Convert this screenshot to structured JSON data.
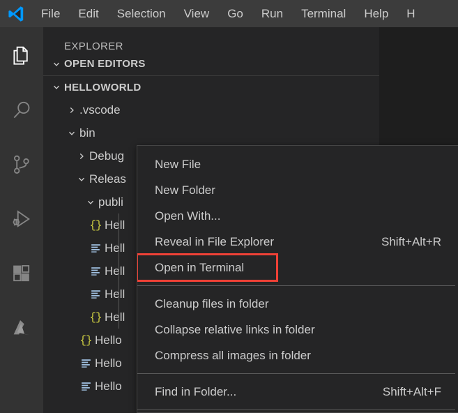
{
  "app": {
    "logo_icon": "vscode-logo-icon",
    "accent_color": "#0098ff",
    "highlight_color": "#ef4136"
  },
  "menubar": {
    "items": [
      {
        "label": "File"
      },
      {
        "label": "Edit"
      },
      {
        "label": "Selection"
      },
      {
        "label": "View"
      },
      {
        "label": "Go"
      },
      {
        "label": "Run"
      },
      {
        "label": "Terminal"
      },
      {
        "label": "Help"
      },
      {
        "label": "H"
      }
    ]
  },
  "activitybar": {
    "items": [
      {
        "name": "explorer",
        "icon": "files-icon",
        "active": true
      },
      {
        "name": "search",
        "icon": "search-icon",
        "active": false
      },
      {
        "name": "source-control",
        "icon": "source-control-icon",
        "active": false
      },
      {
        "name": "run-and-debug",
        "icon": "run-and-debug-icon",
        "active": false
      },
      {
        "name": "extensions",
        "icon": "extensions-icon",
        "active": false
      },
      {
        "name": "azure",
        "icon": "azure-icon",
        "active": false
      }
    ]
  },
  "sidebar": {
    "title": "EXPLORER",
    "sections": [
      {
        "label": "OPEN EDITORS",
        "expanded": true
      },
      {
        "label": "HELLOWORLD",
        "expanded": true
      }
    ],
    "tree": [
      {
        "label": ".vscode",
        "type": "folder",
        "expanded": false,
        "depth": 1,
        "icon": "chevron-right-icon"
      },
      {
        "label": "bin",
        "type": "folder",
        "expanded": true,
        "depth": 1,
        "icon": "chevron-down-icon"
      },
      {
        "label": "Debug",
        "type": "folder",
        "expanded": false,
        "depth": 2,
        "icon": "chevron-right-icon"
      },
      {
        "label": "Releas",
        "type": "folder",
        "expanded": true,
        "depth": 2,
        "icon": "chevron-down-icon"
      },
      {
        "label": "publi",
        "type": "folder",
        "expanded": true,
        "depth": 3,
        "icon": "chevron-down-icon"
      },
      {
        "label": "Hell",
        "type": "file",
        "depth": 4,
        "icon": "json-file-icon"
      },
      {
        "label": "Hell",
        "type": "file",
        "depth": 4,
        "icon": "xml-file-icon"
      },
      {
        "label": "Hell",
        "type": "file",
        "depth": 4,
        "icon": "xml-file-icon"
      },
      {
        "label": "Hell",
        "type": "file",
        "depth": 4,
        "icon": "xml-file-icon"
      },
      {
        "label": "Hell",
        "type": "file",
        "depth": 4,
        "icon": "json-file-icon"
      },
      {
        "label": "Hello",
        "type": "file",
        "depth": 3,
        "icon": "json-file-icon"
      },
      {
        "label": "Hello",
        "type": "file",
        "depth": 3,
        "icon": "xml-file-icon"
      },
      {
        "label": "Hello",
        "type": "file",
        "depth": 3,
        "icon": "xml-file-icon"
      }
    ]
  },
  "context_menu": {
    "items": [
      {
        "label": "New File",
        "shortcut": "",
        "highlighted": false,
        "separator_after": false
      },
      {
        "label": "New Folder",
        "shortcut": "",
        "highlighted": false,
        "separator_after": false
      },
      {
        "label": "Open With...",
        "shortcut": "",
        "highlighted": false,
        "separator_after": false
      },
      {
        "label": "Reveal in File Explorer",
        "shortcut": "Shift+Alt+R",
        "highlighted": false,
        "separator_after": false
      },
      {
        "label": "Open in Terminal",
        "shortcut": "",
        "highlighted": true,
        "separator_after": true
      },
      {
        "label": "Cleanup files in folder",
        "shortcut": "",
        "highlighted": false,
        "separator_after": false
      },
      {
        "label": "Collapse relative links in folder",
        "shortcut": "",
        "highlighted": false,
        "separator_after": false
      },
      {
        "label": "Compress all images in folder",
        "shortcut": "",
        "highlighted": false,
        "separator_after": true
      },
      {
        "label": "Find in Folder...",
        "shortcut": "Shift+Alt+F",
        "highlighted": false,
        "separator_after": true
      }
    ]
  }
}
